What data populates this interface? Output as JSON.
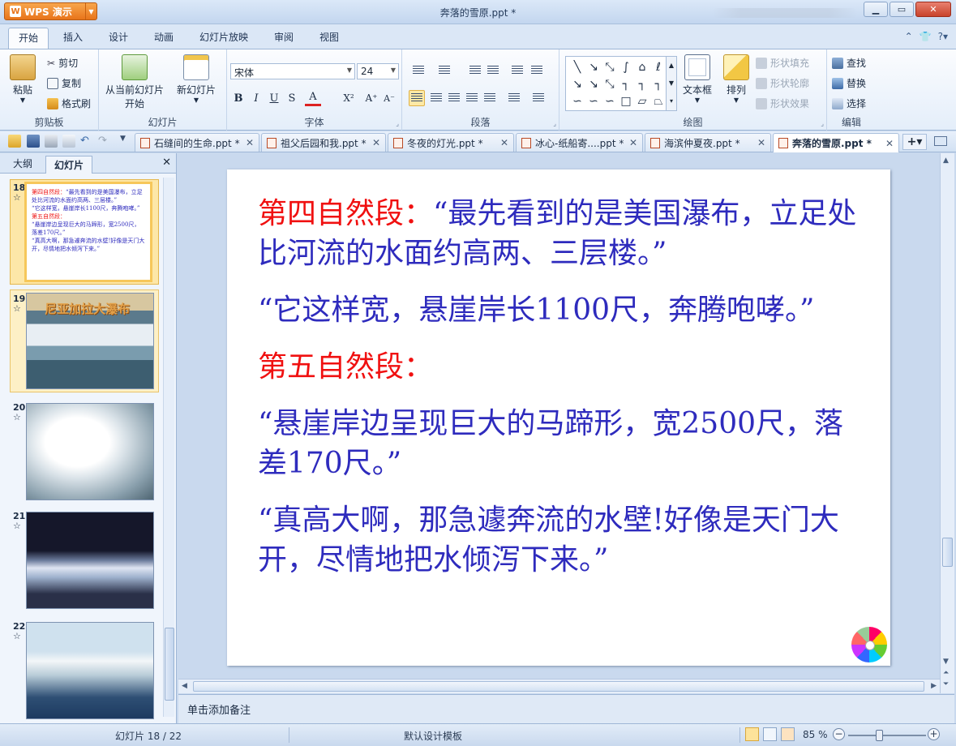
{
  "app": {
    "name": "WPS 演示",
    "window_title": "奔落的雪原.ppt *"
  },
  "window_controls": {
    "minimize": "▁",
    "restore": "▭",
    "close": "✕"
  },
  "menu_tabs": [
    "开始",
    "插入",
    "设计",
    "动画",
    "幻灯片放映",
    "审阅",
    "视图"
  ],
  "menu_right": {
    "collapse": "⌃",
    "skin": "👕",
    "help": "?▾"
  },
  "ribbon": {
    "clipboard": {
      "label": "剪贴板",
      "paste": "粘贴",
      "cut": "剪切",
      "copy": "复制",
      "format_painter": "格式刷"
    },
    "slides": {
      "label": "幻灯片",
      "from_current": "从当前幻灯片",
      "start": "开始",
      "new_slide": "新幻灯片"
    },
    "font": {
      "label": "字体",
      "font_name": "宋体",
      "font_size": "24",
      "bold": "B",
      "italic": "I",
      "underline": "U",
      "strike": "S",
      "color": "A",
      "super": "X²",
      "grow": "A⁺",
      "shrink": "A⁻"
    },
    "paragraph": {
      "label": "段落"
    },
    "drawing": {
      "label": "绘图",
      "textbox": "文本框",
      "arrange": "排列",
      "shape_fill": "形状填充",
      "shape_outline": "形状轮廓",
      "shape_effect": "形状效果"
    },
    "editing": {
      "label": "编辑",
      "find": "查找",
      "replace": "替换",
      "select": "选择"
    }
  },
  "doc_tabs": [
    {
      "title": "石缝间的生命.ppt *",
      "active": false
    },
    {
      "title": "祖父后园和我.ppt *",
      "active": false
    },
    {
      "title": "冬夜的灯光.ppt *",
      "active": false
    },
    {
      "title": "冰心-纸船寄....ppt *",
      "active": false
    },
    {
      "title": "海滨仲夏夜.ppt *",
      "active": false
    },
    {
      "title": "奔落的雪原.ppt *",
      "active": true
    }
  ],
  "left_panel": {
    "tabs": [
      "大纲",
      "幻灯片"
    ],
    "active_tab": "幻灯片",
    "close": "✕",
    "thumbnails": [
      {
        "number": "18",
        "selected": true,
        "mini_lines": [
          "第四自然段：“最先看到的是美国瀑布，立足处比河流的水面约高两、三层楼。”",
          "“它这样宽，悬崖岸长1100尺，奔腾咆哮。”",
          "第五自然段：",
          "“悬崖岸边呈现巨大的马蹄形，宽2500尺，落差170尺。”",
          "“真高大啊，那急遽奔流的水壁!好像是天门大开，尽情地把水倾泻下来。”"
        ]
      },
      {
        "number": "19",
        "selected": false,
        "caption": "尼亚加拉大瀑布"
      },
      {
        "number": "20",
        "selected": false
      },
      {
        "number": "21",
        "selected": false
      },
      {
        "number": "22",
        "selected": false
      }
    ]
  },
  "slide": {
    "paragraphs": [
      {
        "red": "第四自然段：",
        "blue": "“最先看到的是美国瀑布，立足处比河流的水面约高两、三层楼。”"
      },
      {
        "red": "",
        "blue": "“它这样宽，悬崖岸长1100尺，奔腾咆哮。”"
      },
      {
        "red": "第五自然段：",
        "blue": ""
      },
      {
        "red": "",
        "blue": "“悬崖岸边呈现巨大的马蹄形，宽2500尺，落差170尺。”"
      },
      {
        "red": "",
        "blue": "“真高大啊，那急遽奔流的水壁!好像是天门大开，尽情地把水倾泻下来。”"
      }
    ]
  },
  "notes_placeholder": "单击添加备注",
  "status": {
    "slide_counter": "幻灯片 18 / 22",
    "template": "默认设计模板",
    "zoom": "85 %"
  },
  "colors": {
    "slide_red": "#f01010",
    "slide_blue": "#2e2bbd",
    "accent_orange": "#e8741a"
  }
}
